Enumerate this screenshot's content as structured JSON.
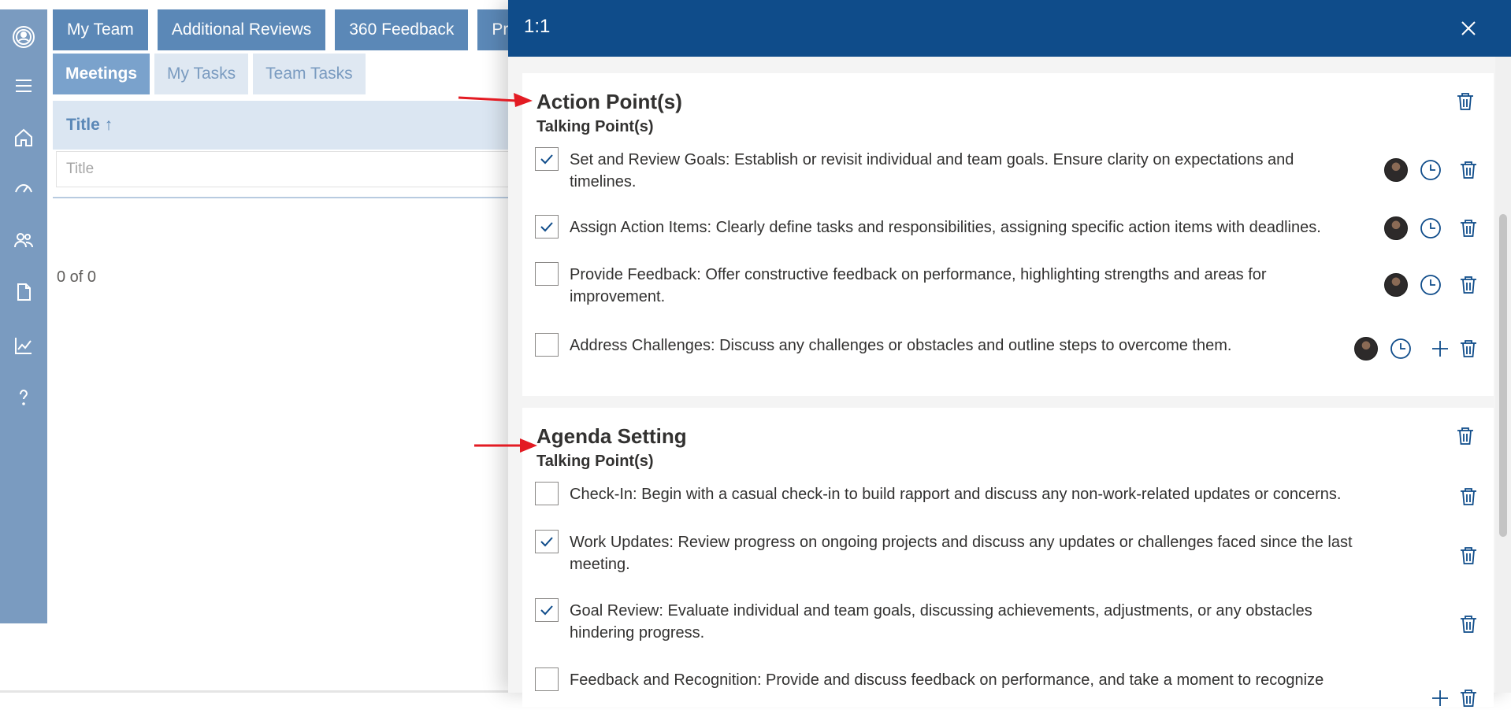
{
  "nav_tabs": [
    "My Team",
    "Additional Reviews",
    "360 Feedback",
    "Pra"
  ],
  "sub_tabs": [
    {
      "label": "Meetings",
      "active": true
    },
    {
      "label": "My Tasks",
      "active": false
    },
    {
      "label": "Team Tasks",
      "active": false
    }
  ],
  "grid": {
    "column_header": "Title ↑",
    "filter_placeholder": "Title",
    "paging": "0 of 0"
  },
  "rail_icons": [
    "profile-icon",
    "menu-icon",
    "home-icon",
    "performance-icon",
    "team-icon",
    "document-icon",
    "chart-icon",
    "help-icon"
  ],
  "panel": {
    "title": "1:1",
    "sections": [
      {
        "title": "Action Point(s)",
        "subtitle": "Talking Point(s)",
        "items": [
          {
            "text": "Set and Review Goals:  Establish or revisit individual and team goals. Ensure clarity on expectations and timelines.",
            "checked": true,
            "avatar": true,
            "clock": true,
            "add": false
          },
          {
            "text": "Assign Action Items:  Clearly define tasks and responsibilities, assigning specific action items with deadlines.",
            "checked": true,
            "avatar": true,
            "clock": true,
            "add": false
          },
          {
            "text": "Provide Feedback:  Offer constructive feedback on performance, highlighting strengths and areas for improvement.",
            "checked": false,
            "avatar": true,
            "clock": true,
            "add": false
          },
          {
            "text": "Address Challenges:  Discuss any challenges or obstacles and outline steps to overcome them.",
            "checked": false,
            "avatar": true,
            "clock": true,
            "add": true
          }
        ]
      },
      {
        "title": "Agenda Setting",
        "subtitle": "Talking Point(s)",
        "items": [
          {
            "text": "Check-In:  Begin with a casual check-in to build rapport and discuss any non-work-related updates or concerns.",
            "checked": false,
            "avatar": false,
            "clock": false,
            "add": false
          },
          {
            "text": "Work Updates:  Review progress on ongoing projects and discuss any updates or challenges faced since the last meeting.",
            "checked": true,
            "avatar": false,
            "clock": false,
            "add": false
          },
          {
            "text": "Goal Review:  Evaluate individual and team goals, discussing achievements, adjustments, or any obstacles hindering progress.",
            "checked": true,
            "avatar": false,
            "clock": false,
            "add": false
          },
          {
            "text": "Feedback and Recognition:  Provide and discuss feedback on performance, and take a moment to recognize",
            "checked": false,
            "avatar": false,
            "clock": false,
            "add": true
          }
        ]
      }
    ]
  },
  "colors": {
    "header_blue": "#0f4c8a",
    "rail": "#7a9bc0",
    "tab": "#5b88b7",
    "annotation_arrow": "#e31b23"
  }
}
